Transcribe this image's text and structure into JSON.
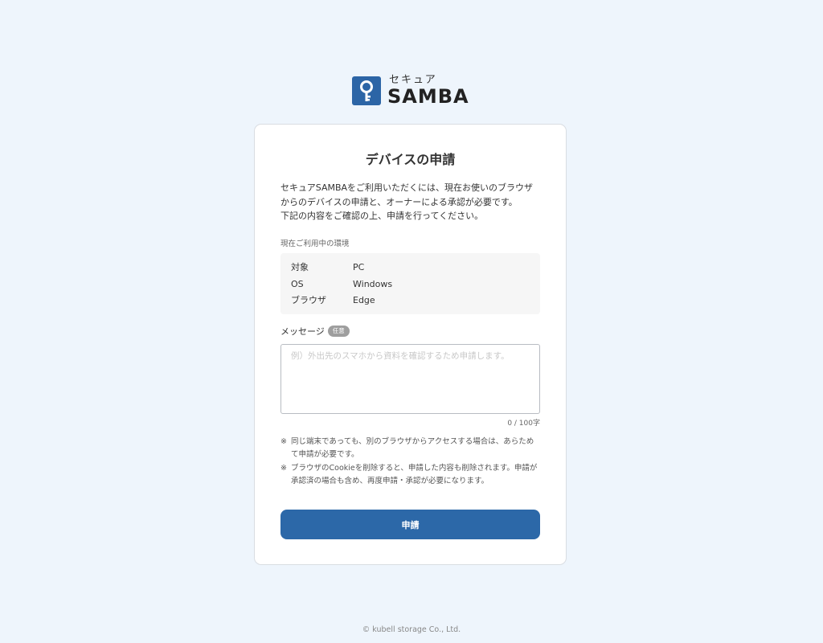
{
  "logo": {
    "sub": "セキュア",
    "main": "SAMBA",
    "icon": "key-icon",
    "color": "#2c65a6"
  },
  "card": {
    "title": "デバイスの申請",
    "description": [
      "セキュアSAMBAをご利用いただくには、現在お使いのブラウザ",
      "からのデバイスの申請と、オーナーによる承認が必要です。",
      "下記の内容をご確認の上、申請を行ってください。"
    ],
    "env_label": "現在ご利用中の環境",
    "env": [
      {
        "key": "対象",
        "value": "PC"
      },
      {
        "key": "OS",
        "value": "Windows"
      },
      {
        "key": "ブラウザ",
        "value": "Edge"
      }
    ],
    "message_label": "メッセージ",
    "optional_badge": "任意",
    "message_placeholder": "例）外出先のスマホから資料を確認するため申請します。",
    "message_value": "",
    "counter": "0 / 100字",
    "notes": [
      {
        "mark": "※",
        "text": "同じ端末であっても、別のブラウザからアクセスする場合は、あらためて申請が必要です。"
      },
      {
        "mark": "※",
        "text": "ブラウザのCookieを削除すると、申請した内容も削除されます。申請が承認済の場合も含め、再度申請・承認が必要になります。"
      }
    ],
    "submit_label": "申請",
    "button_color": "#2c68a8"
  },
  "footer": "© kubell storage Co., Ltd."
}
